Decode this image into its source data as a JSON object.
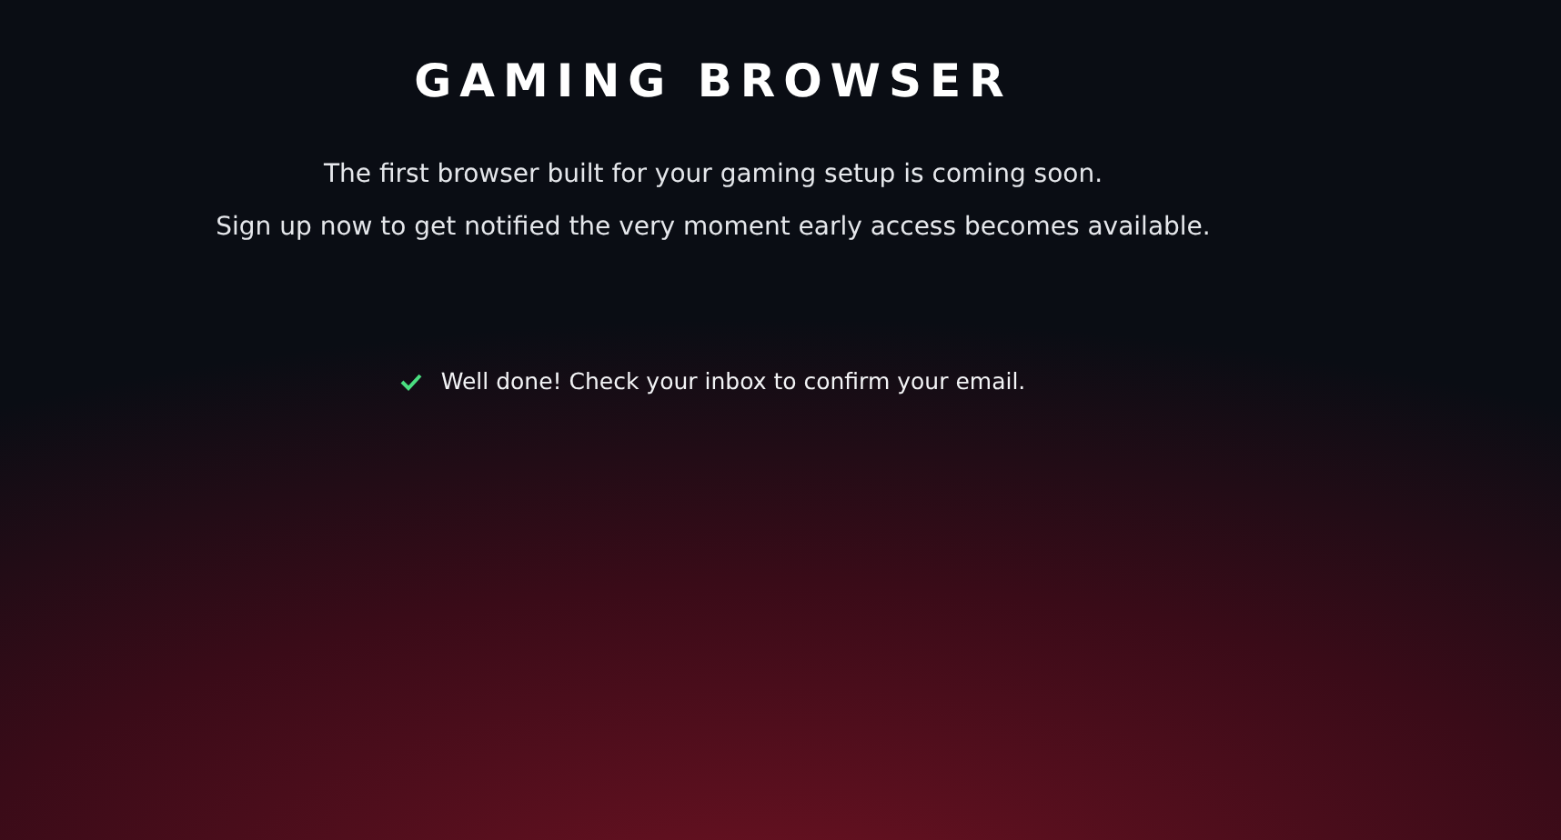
{
  "title": "GAMING BROWSER",
  "intro": [
    "The first browser built for your gaming setup is coming soon.",
    "Sign up now to get notified the very moment early access becomes available."
  ],
  "notice": {
    "kind": "success",
    "text": "Well done! Check your inbox to confirm your email."
  }
}
